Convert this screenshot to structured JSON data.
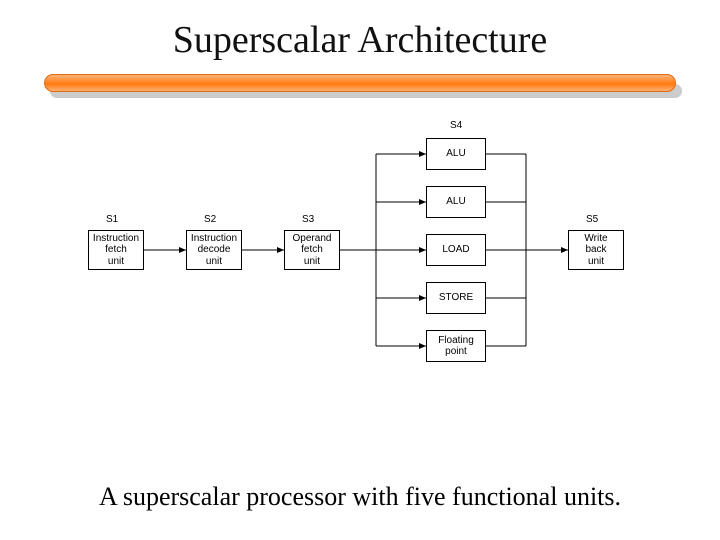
{
  "title": "Superscalar Architecture",
  "caption": "A superscalar processor with five functional units.",
  "stages": {
    "s1": {
      "label": "S1",
      "box": "Instruction\nfetch\nunit"
    },
    "s2": {
      "label": "S2",
      "box": "Instruction\ndecode\nunit"
    },
    "s3": {
      "label": "S3",
      "box": "Operand\nfetch\nunit"
    },
    "s5": {
      "label": "S5",
      "box": "Write\nback\nunit"
    }
  },
  "s4": {
    "label": "S4",
    "units": [
      "ALU",
      "ALU",
      "LOAD",
      "STORE",
      "Floating\npoint"
    ]
  }
}
